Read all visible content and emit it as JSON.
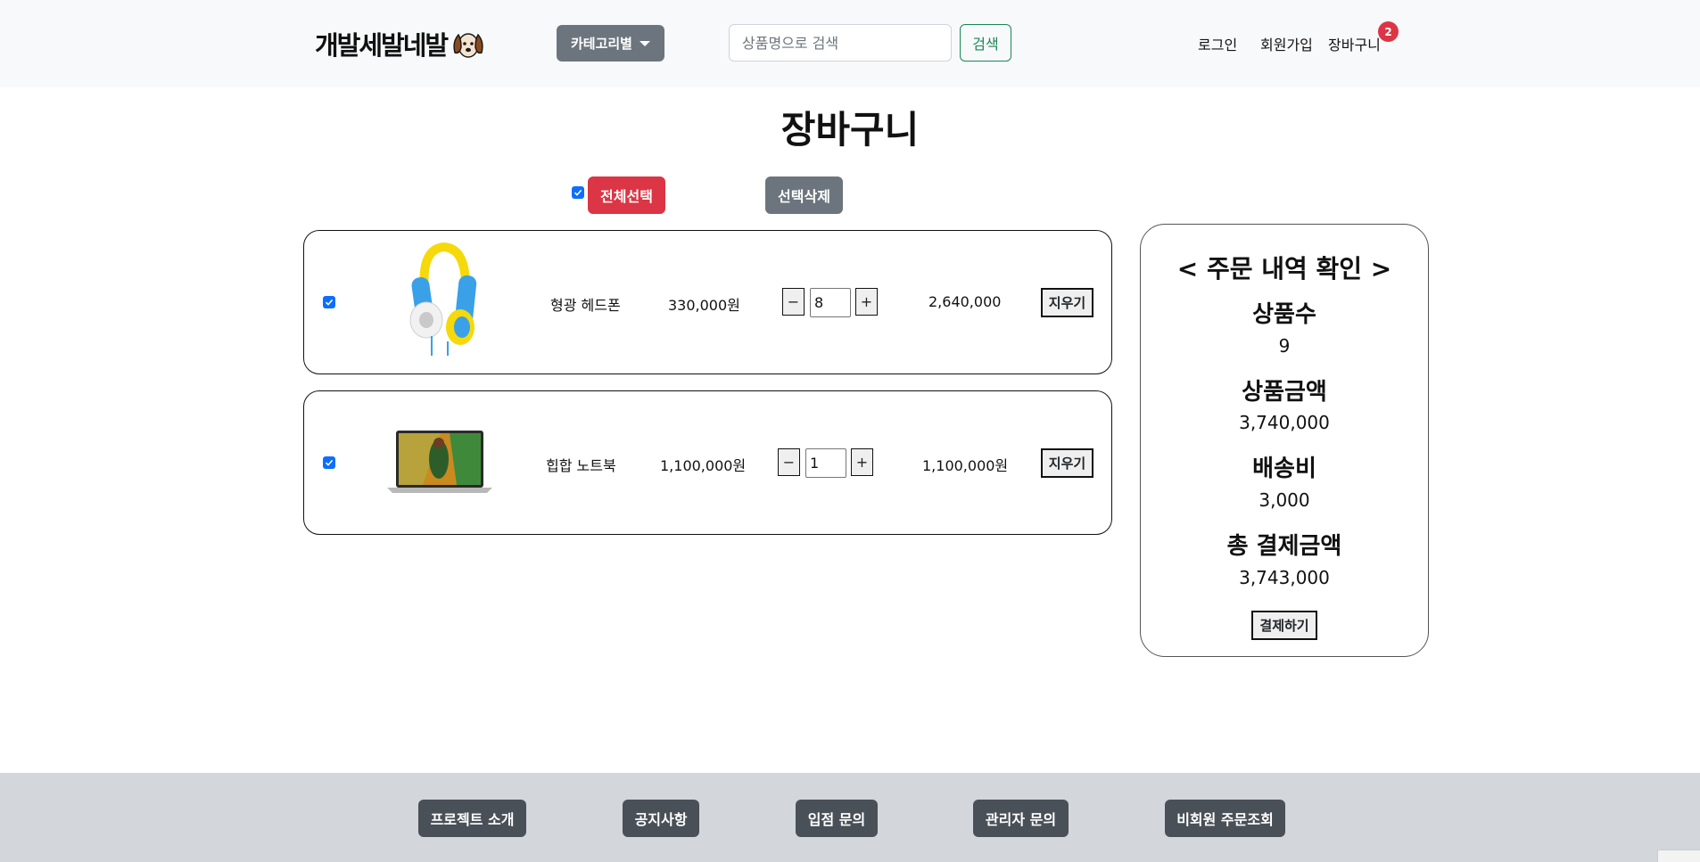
{
  "header": {
    "logo_text": "개발세발네발",
    "category_label": "카테고리별",
    "search_placeholder": "상품명으로 검색",
    "search_button": "검색",
    "login": "로그인",
    "signup": "회원가입",
    "cart": "장바구니",
    "cart_count": "2"
  },
  "page_title": "장바구니",
  "controls": {
    "select_all": "전체선택",
    "delete_selected": "선택삭제"
  },
  "items": [
    {
      "name": "형광 헤드폰",
      "price": "330,000원",
      "quantity": "8",
      "total": "2,640,000",
      "remove": "지우기",
      "checked": true
    },
    {
      "name": "힙합 노트북",
      "price": "1,100,000원",
      "quantity": "1",
      "total": "1,100,000원",
      "remove": "지우기",
      "checked": true
    }
  ],
  "summary": {
    "title": "< 주문 내역 확인 >",
    "count_label": "상품수",
    "count_value": "9",
    "amount_label": "상품금액",
    "amount_value": "3,740,000",
    "shipping_label": "배송비",
    "shipping_value": "3,000",
    "total_label": "총 결제금액",
    "total_value": "3,743,000",
    "pay_button": "결제하기"
  },
  "footer": {
    "buttons": [
      "프로젝트 소개",
      "공지사항",
      "입점 문의",
      "관리자 문의",
      "비회원 주문조회"
    ]
  },
  "colors": {
    "danger": "#dc3545",
    "secondary": "#6c757d",
    "success": "#198754",
    "footer_button": "#495057",
    "checkbox": "#0d6efd"
  }
}
